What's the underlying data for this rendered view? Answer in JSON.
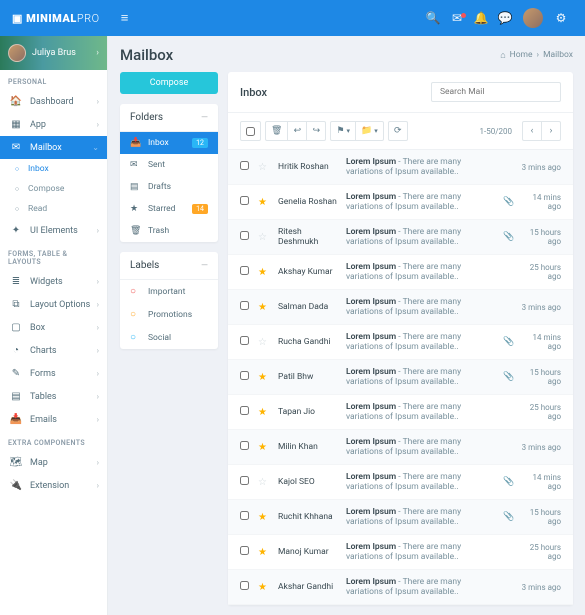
{
  "brand": {
    "p1": "MINIMAL",
    "p2": "PRO"
  },
  "user": {
    "name": "Juliya Brus"
  },
  "page": {
    "title": "Mailbox"
  },
  "crumb": {
    "home": "Home",
    "sep": "›",
    "here": "Mailbox"
  },
  "sidenav": {
    "sect1": "PERSONAL",
    "dashboard": "Dashboard",
    "app": "App",
    "mailbox": "Mailbox",
    "inbox": "Inbox",
    "compose": "Compose",
    "read": "Read",
    "uie": "UI Elements",
    "sect2": "FORMS, TABLE & LAYOUTS",
    "widgets": "Widgets",
    "layout": "Layout Options",
    "box": "Box",
    "charts": "Charts",
    "forms": "Forms",
    "tables": "Tables",
    "emails": "Emails",
    "sect3": "EXTRA COMPONENTS",
    "map": "Map",
    "ext": "Extension"
  },
  "compose_btn": "Compose",
  "folders": {
    "title": "Folders",
    "inbox": {
      "label": "Inbox",
      "badge": "12"
    },
    "sent": {
      "label": "Sent"
    },
    "drafts": {
      "label": "Drafts"
    },
    "starred": {
      "label": "Starred",
      "badge": "14"
    },
    "trash": {
      "label": "Trash"
    }
  },
  "labels": {
    "title": "Labels",
    "important": "Important",
    "promotions": "Promotions",
    "social": "Social"
  },
  "mailbox": {
    "title": "Inbox",
    "search_ph": "Search Mail",
    "pageinfo": "1-50/200"
  },
  "rows": [
    {
      "star": false,
      "sender": "Hritik Roshan",
      "subj": "Lorem Ipsum",
      "body": " - There are many variations of Ipsum available..",
      "att": false,
      "time": "3 mins ago"
    },
    {
      "star": true,
      "sender": "Genelia Roshan",
      "subj": "Lorem Ipsum",
      "body": " - There are many variations of Ipsum available..",
      "att": true,
      "time": "14 mins ago"
    },
    {
      "star": false,
      "sender": "Ritesh Deshmukh",
      "subj": "Lorem Ipsum",
      "body": " - There are many variations of Ipsum available..",
      "att": true,
      "time": "15 hours ago"
    },
    {
      "star": true,
      "sender": "Akshay Kumar",
      "subj": "Lorem Ipsum",
      "body": " - There are many variations of Ipsum available..",
      "att": false,
      "time": "25 hours ago"
    },
    {
      "star": true,
      "sender": "Salman Dada",
      "subj": "Lorem Ipsum",
      "body": " - There are many variations of Ipsum available..",
      "att": false,
      "time": "3 mins ago"
    },
    {
      "star": false,
      "sender": "Rucha Gandhi",
      "subj": "Lorem Ipsum",
      "body": " - There are many variations of Ipsum available..",
      "att": true,
      "time": "14 mins ago"
    },
    {
      "star": true,
      "sender": "Patil Bhw",
      "subj": "Lorem Ipsum",
      "body": " - There are many variations of Ipsum available..",
      "att": true,
      "time": "15 hours ago"
    },
    {
      "star": true,
      "sender": "Tapan Jio",
      "subj": "Lorem Ipsum",
      "body": " - There are many variations of Ipsum available..",
      "att": false,
      "time": "25 hours ago"
    },
    {
      "star": true,
      "sender": "Milin Khan",
      "subj": "Lorem Ipsum",
      "body": " - There are many variations of Ipsum available..",
      "att": false,
      "time": "3 mins ago"
    },
    {
      "star": false,
      "sender": "Kajol SEO",
      "subj": "Lorem Ipsum",
      "body": " - There are many variations of Ipsum available..",
      "att": true,
      "time": "14 mins ago"
    },
    {
      "star": true,
      "sender": "Ruchit Khhana",
      "subj": "Lorem Ipsum",
      "body": " - There are many variations of Ipsum available..",
      "att": true,
      "time": "15 hours ago"
    },
    {
      "star": true,
      "sender": "Manoj Kumar",
      "subj": "Lorem Ipsum",
      "body": " - There are many variations of Ipsum available..",
      "att": false,
      "time": "25 hours ago"
    },
    {
      "star": true,
      "sender": "Akshar Gandhi",
      "subj": "Lorem Ipsum",
      "body": " - There are many variations of Ipsum available..",
      "att": false,
      "time": "3 mins ago"
    }
  ]
}
